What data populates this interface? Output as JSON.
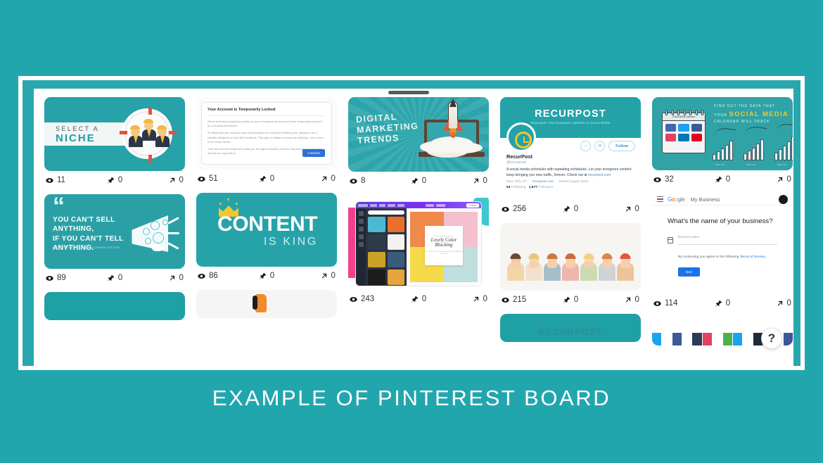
{
  "caption": "EXAMPLE OF PINTEREST BOARD",
  "colors": {
    "background_teal": "#22a6ae",
    "frame_white": "#ffffff",
    "card_teal": "#26a3a9",
    "accent_yellow": "#f3c630",
    "link_blue": "#1a73e8"
  },
  "help_button": "?",
  "stat_icons": {
    "impressions": "eye-icon",
    "saves": "pin-icon",
    "clicks": "arrow-out-icon"
  },
  "pins": {
    "niche": {
      "line1": "SELECT A",
      "line2": "NICHE",
      "impressions": "11",
      "saves": "0",
      "clicks": "0"
    },
    "locked": {
      "heading": "Your Account is Temporarily Locked",
      "p1": "We've detected suspicious activity on your Facebook account and have temporarily locked it as a security precaution.",
      "p2": "It's likely that your account was compromised as a result of entering your password on a website designed to look like Facebook. This type of attack is known as phishing. Learn more in the Help Center.",
      "p3": "Over the next few steps we'll walk you through a security check to help secure your account, and let you log back in.",
      "button": "Continue",
      "impressions": "51",
      "saves": "0",
      "clicks": "0"
    },
    "trends": {
      "line1": "DIGITAL",
      "line2": "MARKETING",
      "line3": "TRENDS",
      "impressions": "8",
      "saves": "0",
      "clicks": "0"
    },
    "twitter": {
      "brand": "RECURPOST",
      "tagline": "Repurpose Your Evergreen Updates on Social Media",
      "name": "RecurPost",
      "handle": "@recurpost",
      "bio": "A social media scheduler with repeating schedules. Let your evergreen content keep bringing you new traffic, forever. Check out at ",
      "bio_link": "recurpost.com",
      "location": "New York, NY",
      "website": "recurpost.com",
      "joined": "Joined August 2016",
      "following_count": "54",
      "following_label": "Following",
      "followers_count": "1,577",
      "followers_label": "Followers",
      "follow_button": "Follow",
      "more_icon": "ellipsis-icon",
      "message_icon": "envelope-icon",
      "impressions": "256",
      "saves": "0",
      "clicks": "0"
    },
    "calendar": {
      "line1": "FIND OUT THE DATA THAT",
      "line2_pre": "YOUR ",
      "line2_bold": "SOCIAL MEDIA",
      "line3": "CALENDAR WILL TRACK",
      "cal_title": "Social Media Calendar",
      "group1_label": "OCT 18",
      "group2_label": "NOV 18",
      "group3_label": "DEC 18",
      "impressions": "32",
      "saves": "0",
      "clicks": "0"
    },
    "quote": {
      "quote_mark": "“",
      "line1": "YOU CAN'T SELL",
      "line2": "ANYTHING,",
      "line3": "IF YOU CAN'T TELL",
      "line4": "ANYTHING.",
      "attribution": "BETH COMSTOCK, EX-CHAIR OF GENERAL ELECTRIC",
      "impressions": "89",
      "saves": "0",
      "clicks": "0"
    },
    "king": {
      "line1": "CONTENT",
      "line2": "IS KING",
      "impressions": "86",
      "saves": "0",
      "clicks": "0"
    },
    "canva": {
      "card_eyebrow": "THE EDITORIAL",
      "card_title_1": "Lovely Color",
      "card_title_2": "Blocking",
      "card_body": "Lorem ipsum dolor sit amet consectetur adipiscing elit sed do",
      "toolbar_button": "Publish",
      "impressions": "243",
      "saves": "0",
      "clicks": "0"
    },
    "people": {
      "impressions": "215",
      "saves": "0",
      "clicks": "0"
    },
    "gmb": {
      "logo": "Google",
      "product": "My Business",
      "question": "What's the name of your business?",
      "field_label": "Business name",
      "field_value": "",
      "terms_prefix": "By continuing you agree to the following ",
      "terms_link": "Terms of Service",
      "next_button": "Next",
      "menu_icon": "hamburger-icon",
      "avatar_icon": "avatar",
      "impressions": "114",
      "saves": "0",
      "clicks": "0"
    },
    "bottom_recurpost": {
      "brand": "RECURPOST"
    }
  }
}
